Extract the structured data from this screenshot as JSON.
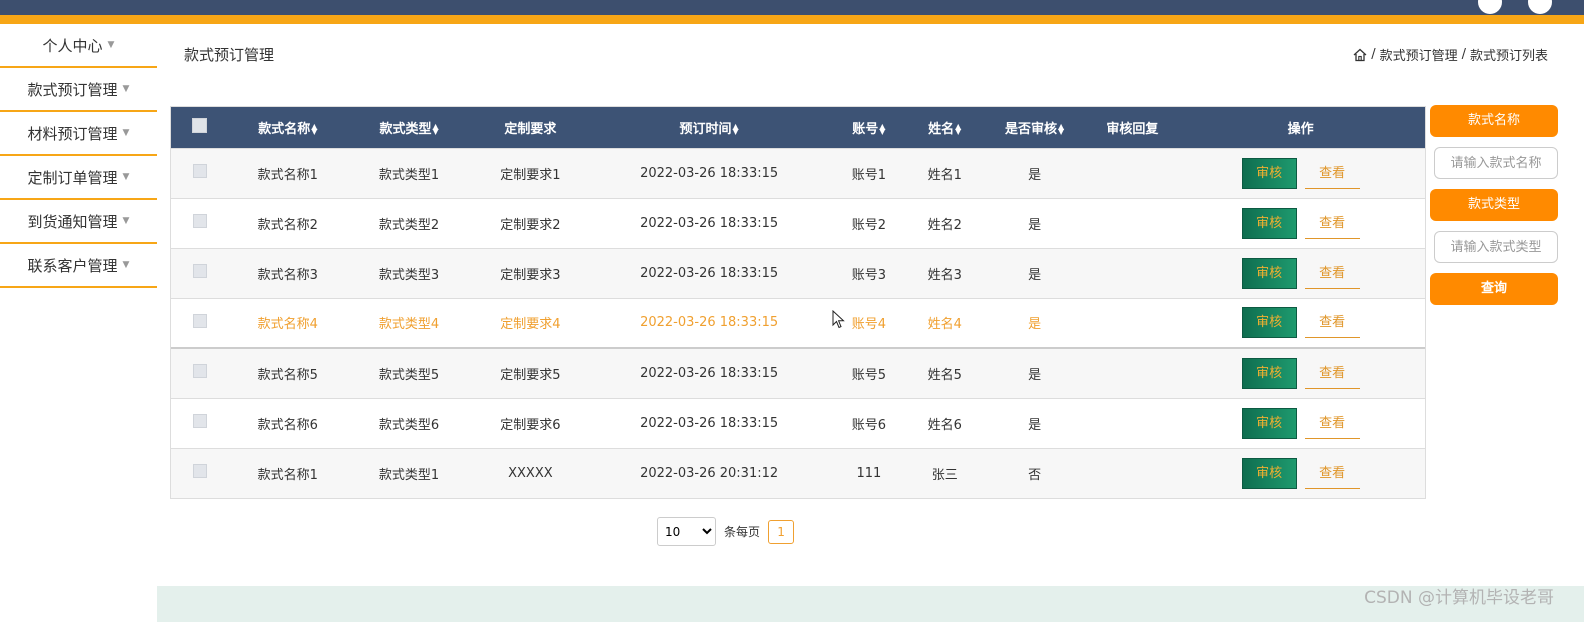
{
  "sidebar": {
    "items": [
      {
        "label": "个人中心"
      },
      {
        "label": "款式预订管理"
      },
      {
        "label": "材料预订管理"
      },
      {
        "label": "定制订单管理"
      },
      {
        "label": "到货通知管理"
      },
      {
        "label": "联系客户管理"
      }
    ]
  },
  "header": {
    "title": "款式预订管理",
    "breadcrumb": [
      "款式预订管理",
      "款式预订列表"
    ],
    "separator": "/"
  },
  "table": {
    "columns": [
      "款式名称",
      "款式类型",
      "定制要求",
      "预订时间",
      "账号",
      "姓名",
      "是否审核",
      "审核回复",
      "操作"
    ],
    "sortable": [
      true,
      true,
      false,
      true,
      true,
      true,
      true,
      false,
      false
    ],
    "rows": [
      [
        "款式名称1",
        "款式类型1",
        "定制要求1",
        "2022-03-26 18:33:15",
        "账号1",
        "姓名1",
        "是",
        ""
      ],
      [
        "款式名称2",
        "款式类型2",
        "定制要求2",
        "2022-03-26 18:33:15",
        "账号2",
        "姓名2",
        "是",
        ""
      ],
      [
        "款式名称3",
        "款式类型3",
        "定制要求3",
        "2022-03-26 18:33:15",
        "账号3",
        "姓名3",
        "是",
        ""
      ],
      [
        "款式名称4",
        "款式类型4",
        "定制要求4",
        "2022-03-26 18:33:15",
        "账号4",
        "姓名4",
        "是",
        ""
      ],
      [
        "款式名称5",
        "款式类型5",
        "定制要求5",
        "2022-03-26 18:33:15",
        "账号5",
        "姓名5",
        "是",
        ""
      ],
      [
        "款式名称6",
        "款式类型6",
        "定制要求6",
        "2022-03-26 18:33:15",
        "账号6",
        "姓名6",
        "是",
        ""
      ],
      [
        "款式名称1",
        "款式类型1",
        "XXXXX",
        "2022-03-26 20:31:12",
        "111",
        "张三",
        "否",
        ""
      ]
    ],
    "audit_label": "审核",
    "view_label": "查看"
  },
  "search": {
    "name_label": "款式名称",
    "name_placeholder": "请输入款式名称",
    "type_label": "款式类型",
    "type_placeholder": "请输入款式类型",
    "query_label": "查询"
  },
  "pagination": {
    "page_size": "10",
    "page_size_suffix": "条每页",
    "current_page": "1"
  },
  "watermark": "CSDN @计算机毕设老哥",
  "colors": {
    "topbar": "#3d4f6e",
    "accent": "#f7a616",
    "header_row": "#3d5375",
    "orange_button": "#ff8a00",
    "audit_button": "#0f6e50"
  }
}
